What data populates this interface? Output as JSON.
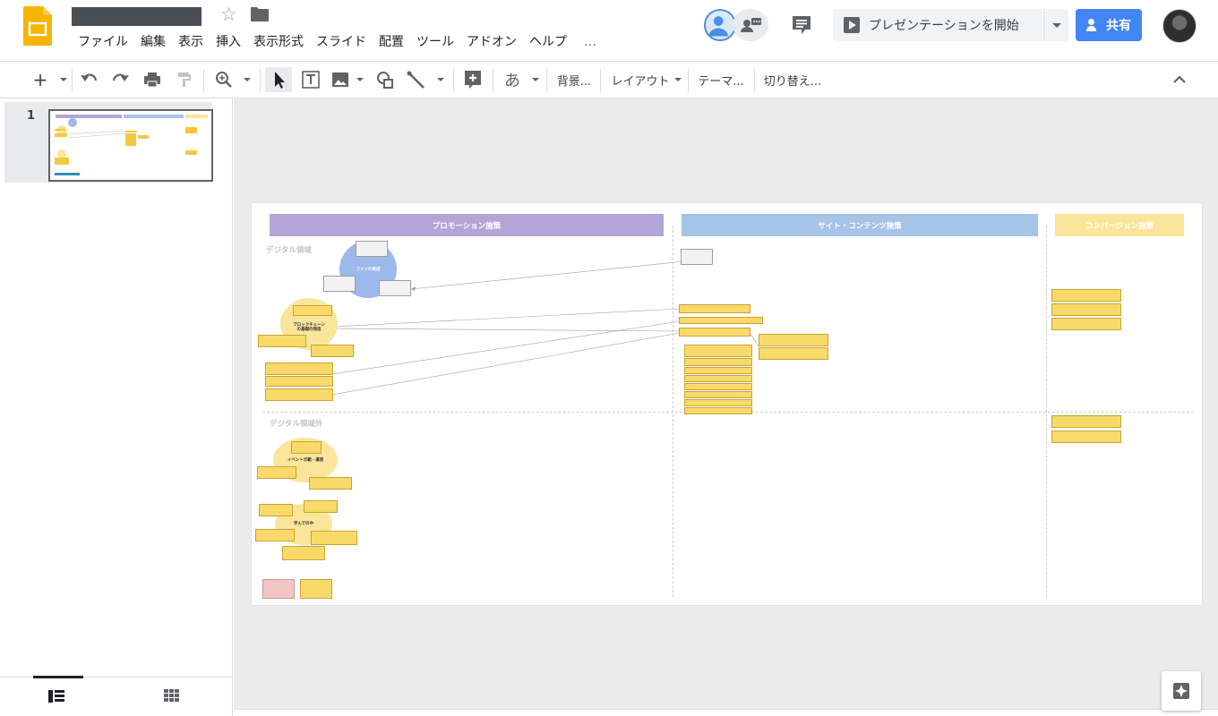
{
  "menu": {
    "items": [
      "ファイル",
      "編集",
      "表示",
      "挿入",
      "表示形式",
      "スライド",
      "配置",
      "ツール",
      "アドオン",
      "ヘルプ"
    ],
    "more": "…"
  },
  "header": {
    "present_label": "プレゼンテーションを開始",
    "share_label": "共有"
  },
  "toolbar": {
    "input_tools_label": "あ",
    "background_label": "背景...",
    "layout_label": "レイアウト",
    "theme_label": "テーマ...",
    "transition_label": "切り替え..."
  },
  "filmstrip": {
    "slide_number": "1"
  },
  "slide": {
    "col_headers": [
      "プロモーション施策",
      "サイト・コンテンツ施策",
      "コンバージョン施策"
    ],
    "header_colors": [
      "#b3a6d6",
      "#a6c3e8",
      "#fbe59a"
    ],
    "region_digital": "デジタル領域",
    "region_non_digital": "デジタル領域外",
    "circle_labels": {
      "fans": "ファンの育成",
      "blockchain": "ブロックチェーン\nの基礎の発信",
      "event": "イベント示範・運営",
      "study": "学んでの中"
    }
  }
}
